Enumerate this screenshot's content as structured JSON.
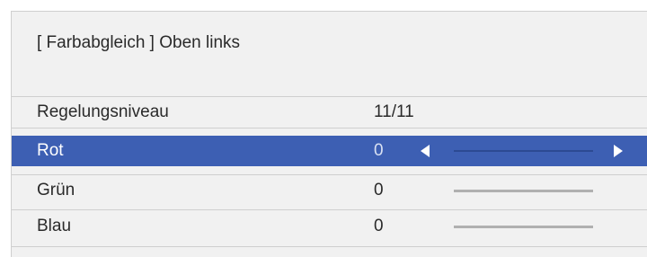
{
  "header": {
    "title": "[ Farbabgleich ] Oben links"
  },
  "rows": [
    {
      "label": "Regelungsniveau",
      "value": "11/11"
    },
    {
      "label": "Rot",
      "value": "0",
      "selected": true,
      "level": 1.0
    },
    {
      "label": "Grün",
      "value": "0",
      "level": 0.0
    },
    {
      "label": "Blau",
      "value": "0",
      "level": 0.0
    }
  ],
  "colors": {
    "selection": "#3d5fb3",
    "background": "#f1f1f1",
    "slider_track": "#b0b0b0"
  },
  "icons": {
    "left": "arrow-left-icon",
    "right": "arrow-right-icon"
  }
}
